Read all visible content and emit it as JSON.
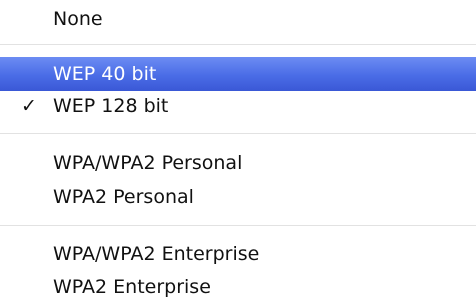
{
  "menu": {
    "items": [
      {
        "label": "None"
      },
      {
        "label": "WEP 40 bit",
        "highlighted": true
      },
      {
        "label": "WEP 128 bit",
        "checked": true,
        "check_mark": "✓"
      },
      {
        "label": "WPA/WPA2 Personal"
      },
      {
        "label": "WPA2 Personal"
      },
      {
        "label": "WPA/WPA2 Enterprise"
      },
      {
        "label": "WPA2 Enterprise"
      }
    ]
  },
  "colors": {
    "highlight": "#4a6ce6",
    "highlight_text": "#ffffff",
    "text": "#111111",
    "separator": "#e2e2e2"
  }
}
